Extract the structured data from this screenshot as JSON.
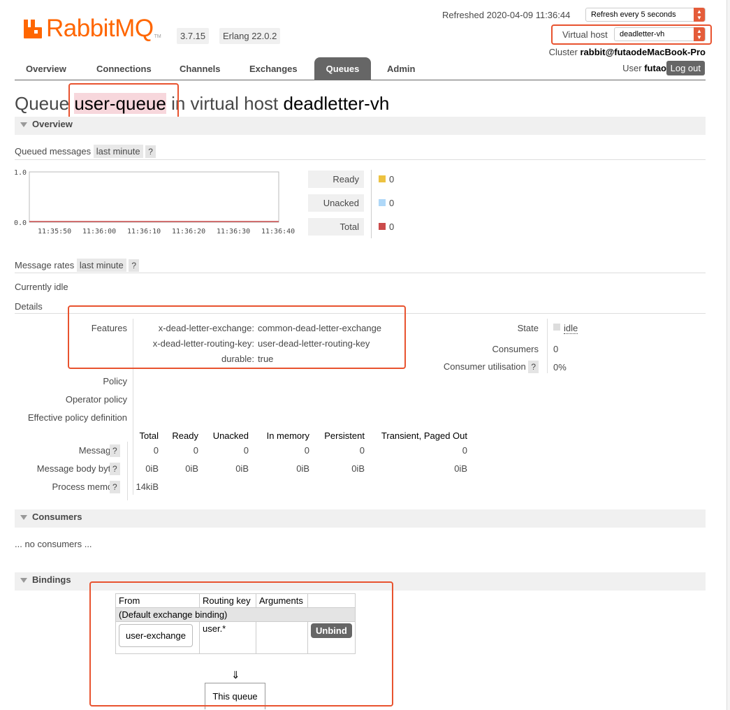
{
  "header": {
    "logo_text": "RabbitMQ",
    "logo_tm": "TM",
    "version": "3.7.15",
    "erlang": "Erlang 22.0.2",
    "refreshed": "Refreshed 2020-04-09 11:36:44",
    "refresh_select": "Refresh every 5 seconds",
    "vhost_label": "Virtual host",
    "vhost_select": "deadletter-vh",
    "cluster_label": "Cluster",
    "cluster_name": "rabbit@futaodeMacBook-Pro",
    "user_label": "User",
    "user_name": "futao",
    "logout": "Log out"
  },
  "nav": {
    "overview": "Overview",
    "connections": "Connections",
    "channels": "Channels",
    "exchanges": "Exchanges",
    "queues": "Queues",
    "admin": "Admin"
  },
  "title": {
    "prefix": "Queue",
    "queue": "user-queue",
    "middle": "in virtual host",
    "vhost": "deadletter-vh"
  },
  "overview": {
    "heading": "Overview",
    "queued_label": "Queued messages",
    "queued_range": "last minute",
    "help": "?",
    "chart": {
      "y_top": "1.0",
      "y_bottom": "0.0",
      "x_ticks": [
        "11:35:50",
        "11:36:00",
        "11:36:10",
        "11:36:20",
        "11:36:30",
        "11:36:40"
      ]
    },
    "legend": [
      {
        "label": "Ready",
        "value": "0",
        "color": "#edc240"
      },
      {
        "label": "Unacked",
        "value": "0",
        "color": "#afd8f8"
      },
      {
        "label": "Total",
        "value": "0",
        "color": "#cb4b4b"
      }
    ],
    "rates_label": "Message rates",
    "rates_range": "last minute",
    "idle": "Currently idle",
    "details": "Details"
  },
  "details": {
    "features_label": "Features",
    "features": [
      {
        "key": "x-dead-letter-exchange:",
        "value": "common-dead-letter-exchange"
      },
      {
        "key": "x-dead-letter-routing-key:",
        "value": "user-dead-letter-routing-key"
      },
      {
        "key": "durable:",
        "value": "true"
      }
    ],
    "policy": "Policy",
    "operator_policy": "Operator policy",
    "effective_policy": "Effective policy definition",
    "state_label": "State",
    "state_value": "idle",
    "consumers_label": "Consumers",
    "consumers_value": "0",
    "utilisation_label": "Consumer utilisation",
    "utilisation_value": "0%"
  },
  "stats": {
    "columns": [
      "Total",
      "Ready",
      "Unacked",
      "In memory",
      "Persistent",
      "Transient, Paged Out"
    ],
    "rows": [
      {
        "label": "Messages",
        "values": [
          "0",
          "0",
          "0",
          "0",
          "0",
          "0"
        ]
      },
      {
        "label": "Message body bytes",
        "values": [
          "0iB",
          "0iB",
          "0iB",
          "0iB",
          "0iB",
          "0iB"
        ]
      },
      {
        "label": "Process memory",
        "values": [
          "14kiB"
        ]
      }
    ]
  },
  "consumers": {
    "heading": "Consumers",
    "none": "... no consumers ..."
  },
  "bindings": {
    "heading": "Bindings",
    "col_from": "From",
    "col_key": "Routing key",
    "col_args": "Arguments",
    "default_row": "(Default exchange binding)",
    "exchange": "user-exchange",
    "routing_key": "user.*",
    "unbind": "Unbind",
    "arrow": "⇓",
    "this_queue": "This queue"
  },
  "colors": {
    "accent": "#ff6600",
    "highlight": "#e8532f"
  }
}
